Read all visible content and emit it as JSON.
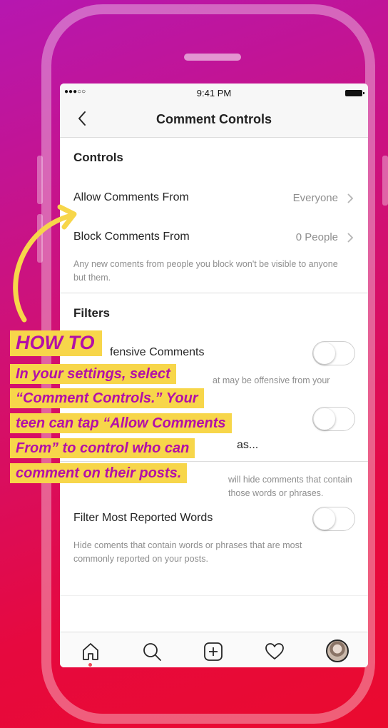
{
  "status_bar": {
    "signal": "●●●○○",
    "time": "9:41 PM"
  },
  "nav": {
    "title": "Comment Controls"
  },
  "controls": {
    "title": "Controls",
    "allow_label": "Allow Comments From",
    "allow_value": "Everyone",
    "block_label": "Block Comments From",
    "block_value": "0 People",
    "block_desc": "Any new coments from people you block won't be visible to anyone but them."
  },
  "filters": {
    "title": "Filters",
    "offensive_label_visible": "fensive Comments",
    "offensive_desc_visible": "at may be offensive from your",
    "manual_label_visible": "as...",
    "manual_desc_visible": "will hide comments that contain those words or phrases.",
    "reported_label": "Filter Most Reported Words",
    "reported_desc": "Hide coments that contain words or phrases that are most commonly reported on your posts."
  },
  "toggles": {
    "hide_offensive": false,
    "manual_filter": false,
    "most_reported": false
  },
  "tabbar": {
    "items": [
      {
        "icon": "home-icon"
      },
      {
        "icon": "search-icon"
      },
      {
        "icon": "add-post-icon"
      },
      {
        "icon": "heart-icon"
      },
      {
        "icon": "profile-avatar"
      }
    ]
  },
  "overlay": {
    "title": "HOW TO",
    "lines": [
      "In your settings, select",
      "“Comment Controls.” Your",
      "teen can tap “Allow Comments",
      "From” to control who can",
      "comment on their posts."
    ]
  },
  "colors": {
    "background_top": "#b617b0",
    "background_bottom": "#ea0a2e",
    "callout_bg": "#f7d64a",
    "callout_text": "#b30fa8",
    "arrow": "#f7d64a"
  }
}
